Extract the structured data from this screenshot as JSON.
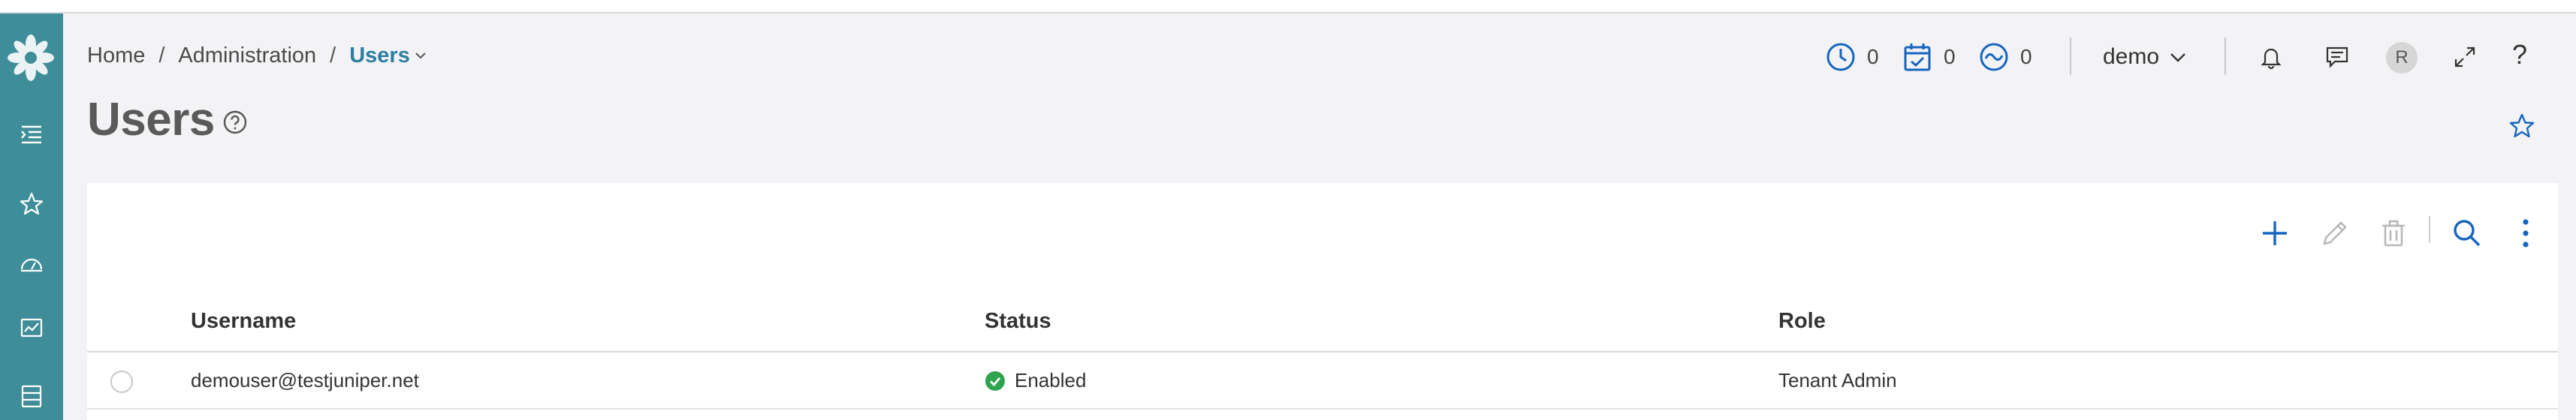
{
  "breadcrumb": {
    "home": "Home",
    "admin": "Administration",
    "current": "Users",
    "separator": "/"
  },
  "page": {
    "title": "Users"
  },
  "header": {
    "counters": [
      {
        "icon": "clock-icon",
        "value": "0"
      },
      {
        "icon": "calendar-check-icon",
        "value": "0"
      },
      {
        "icon": "wave-circle-icon",
        "value": "0"
      }
    ],
    "user": "demo",
    "avatar_initial": "R",
    "help_label": "?"
  },
  "sidebar": {
    "items": [
      {
        "icon": "menu-expand-icon"
      },
      {
        "icon": "star-icon"
      },
      {
        "icon": "dashboard-gauge-icon"
      },
      {
        "icon": "monitor-chart-icon"
      },
      {
        "icon": "devices-icon"
      }
    ]
  },
  "toolbar": {
    "actions": [
      "add-icon",
      "edit-icon",
      "delete-icon",
      "search-icon",
      "more-vertical-icon"
    ]
  },
  "table": {
    "columns": [
      "Username",
      "Status",
      "Role"
    ],
    "rows": [
      {
        "username": "demouser@testjuniper.net",
        "status": "Enabled",
        "role": "Tenant Admin"
      }
    ]
  },
  "colors": {
    "rail": "#3f8d99",
    "accent": "#1565c0",
    "breadcrumb_current": "#2b7fa0",
    "status_enabled": "#2ea44f",
    "disabled_icon": "#b8b8b8"
  }
}
